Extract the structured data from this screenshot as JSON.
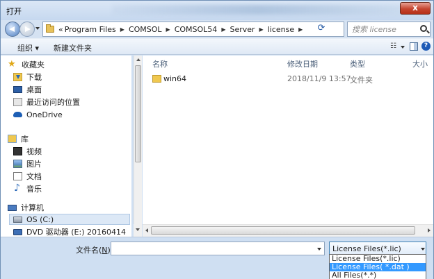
{
  "window": {
    "title": "打开",
    "close_label": "x"
  },
  "address": {
    "prefix": "«",
    "crumbs": [
      "Program Files",
      "COMSOL",
      "COMSOL54",
      "Server",
      "license"
    ],
    "search_placeholder": "搜索 license"
  },
  "toolbar": {
    "organize_label": "组织 ▾",
    "new_folder_label": "新建文件夹"
  },
  "nav": {
    "favorites": "收藏夹",
    "downloads": "下载",
    "desktop": "桌面",
    "recent": "最近访问的位置",
    "onedrive": "OneDrive",
    "libraries": "库",
    "videos": "视频",
    "pictures": "图片",
    "documents": "文档",
    "music": "音乐",
    "computer": "计算机",
    "os_drive": "OS (C:)",
    "dvd_drive": "DVD 驱动器 (E:) 20160414"
  },
  "columns": {
    "name": "名称",
    "date": "修改日期",
    "type": "类型",
    "size": "大小"
  },
  "files": [
    {
      "name": "win64",
      "date": "2018/11/9 13:57",
      "type": "文件夹"
    }
  ],
  "bottom": {
    "filename_label": "文件名(",
    "filename_hotkey": "N",
    "filename_label_end": "):",
    "filename_value": "",
    "filter_selected": "License Files(*.lic)",
    "filter_options": [
      "License Files(*.lic)",
      "License Files( *.dat )",
      "All Files(*.*)"
    ],
    "filter_highlighted_index": 1
  }
}
